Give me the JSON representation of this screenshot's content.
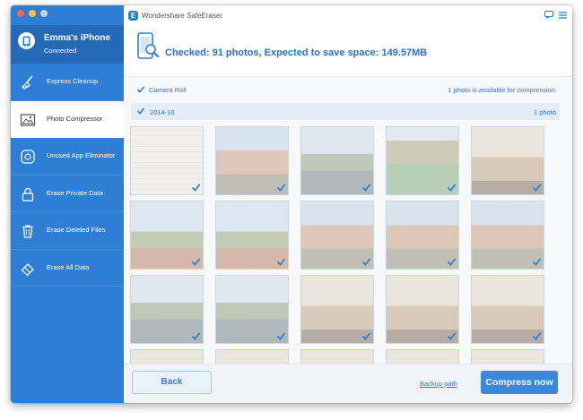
{
  "device": {
    "name": "Emma's iPhone",
    "status": "Connected"
  },
  "sidebar": {
    "items": [
      {
        "label": "Express Cleanup",
        "icon": "broom-icon"
      },
      {
        "label": "Photo Compressor",
        "icon": "photo-icon"
      },
      {
        "label": "Unused App Eliminator",
        "icon": "app-icon"
      },
      {
        "label": "Erase Private Data",
        "icon": "lock-icon"
      },
      {
        "label": "Erase Deleted Files",
        "icon": "trash-icon"
      },
      {
        "label": "Erase All Data",
        "icon": "eraser-icon"
      }
    ],
    "active_index": 1
  },
  "window": {
    "title": "Wondershare SafeEraser",
    "logo_letter": "E"
  },
  "summary": {
    "text": "Checked: 91 photos, Expected to save space: 149.57MB"
  },
  "album": {
    "label": "Camera Roll",
    "info": "1 photo is available for compression."
  },
  "group": {
    "label": "2014-10",
    "count": "1 photo"
  },
  "photos": [
    {
      "style": "document"
    },
    {
      "style": "buildings"
    },
    {
      "style": "river"
    },
    {
      "style": "aerial"
    },
    {
      "style": "room"
    },
    {
      "style": "landscape"
    },
    {
      "style": "landscape"
    },
    {
      "style": "buildings"
    },
    {
      "style": "buildings"
    },
    {
      "style": "buildings"
    },
    {
      "style": "river"
    },
    {
      "style": "river"
    },
    {
      "style": "room"
    },
    {
      "style": "room"
    },
    {
      "style": "room"
    },
    {
      "style": "room"
    },
    {
      "style": "room"
    },
    {
      "style": "room"
    },
    {
      "style": "room"
    },
    {
      "style": "room"
    }
  ],
  "footer": {
    "back_label": "Back",
    "backup_label": "Backup path",
    "compress_label": "Compress now"
  },
  "colors": {
    "sidebar": "#2f7ed6",
    "device_bg": "#2469b7",
    "accent": "#3b87d9",
    "text_blue": "#3377cc"
  }
}
